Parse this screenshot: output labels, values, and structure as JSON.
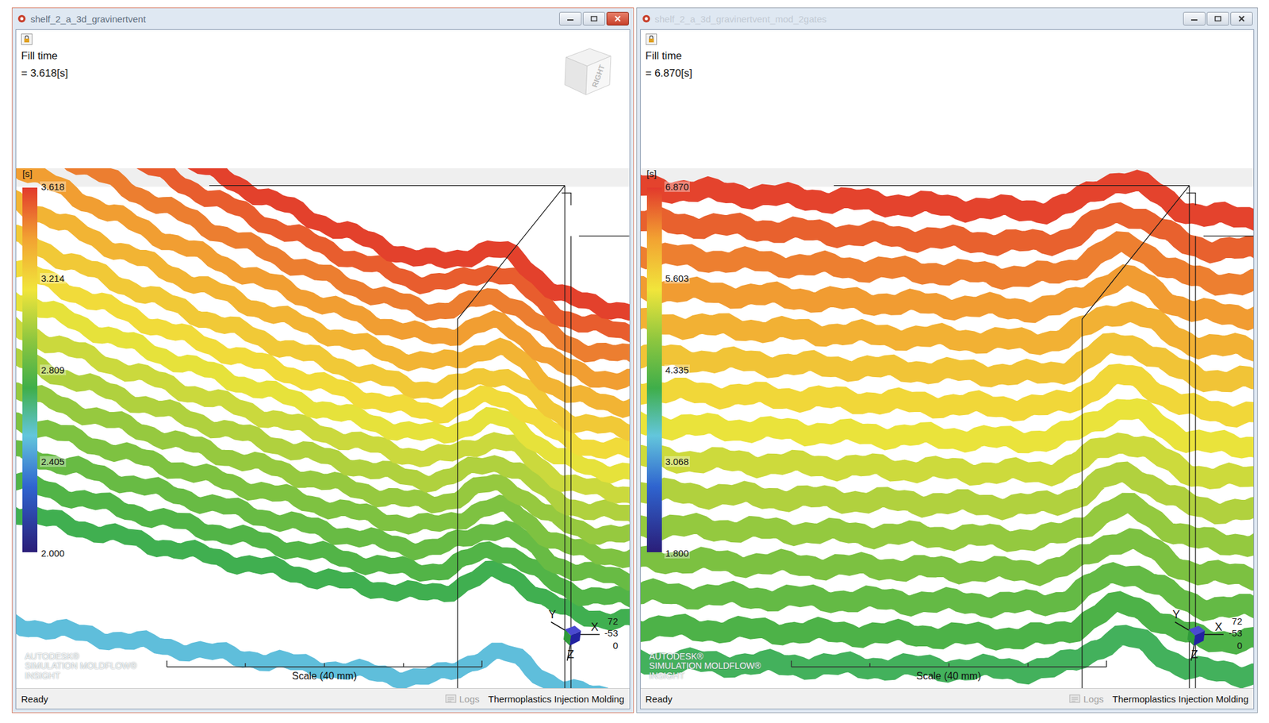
{
  "windows": [
    {
      "title": "shelf_2_a_3d_gravinertvent",
      "active": true,
      "result": {
        "name": "Fill time",
        "value": "= 3.618[s]"
      },
      "view_cube": "RIGHT",
      "legend": {
        "unit": "[s]",
        "ticks": [
          "3.618",
          "3.214",
          "2.809",
          "2.405",
          "2.000"
        ]
      },
      "contours": {
        "values": [
          2.5,
          2.72,
          2.78,
          2.84,
          2.9,
          2.96,
          3.02,
          3.08,
          3.14,
          3.2,
          3.26,
          3.33,
          3.4,
          3.47,
          3.54,
          3.6
        ]
      },
      "triad": {
        "labels": [
          "Y",
          "X",
          "Z"
        ],
        "readout": [
          "72",
          "-53",
          "0"
        ]
      },
      "scale": "Scale (40 mm)",
      "logo": [
        "AUTODESK®",
        "SIMULATION MOLDFLOW®",
        "INSIGHT"
      ],
      "status": {
        "text": "Ready",
        "logs": "Logs",
        "mode": "Thermoplastics Injection Molding"
      }
    },
    {
      "title": "shelf_2_a_3d_gravinertvent_mod_2gates",
      "active": false,
      "result": {
        "name": "Fill time",
        "value": "= 6.870[s]"
      },
      "view_cube": "",
      "legend": {
        "unit": "[s]",
        "ticks": [
          "6.870",
          "5.603",
          "4.335",
          "3.068",
          "1.800"
        ]
      },
      "contours": {
        "values": [
          4.0,
          4.2,
          4.4,
          4.6,
          4.8,
          5.0,
          5.2,
          5.4,
          5.6,
          5.8,
          6.0,
          6.2,
          6.4,
          6.6,
          6.8
        ]
      },
      "triad": {
        "labels": [
          "Y",
          "X",
          "Z"
        ],
        "readout": [
          "72",
          "-53",
          "0"
        ]
      },
      "scale": "Scale (40 mm)",
      "logo": [
        "AUTODESK®",
        "SIMULATION MOLDFLOW®",
        "INSIGHT"
      ],
      "status": {
        "text": "Ready",
        "logs": "Logs",
        "mode": "Thermoplastics Injection Molding"
      }
    }
  ]
}
